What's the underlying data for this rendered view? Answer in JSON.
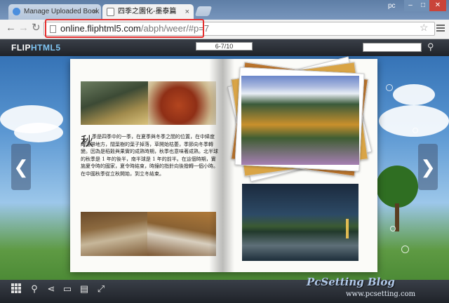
{
  "browser": {
    "tabs": [
      {
        "label": "Manage Uploaded Book",
        "active": false
      },
      {
        "label": "四季之園化-墨泰篇",
        "active": true
      }
    ],
    "close_glyph": "×",
    "user_label": "pc",
    "window_buttons": {
      "minimize": "–",
      "maximize": "□",
      "close": "✕"
    },
    "nav": {
      "back": "←",
      "forward": "→",
      "reload": "↻"
    },
    "address": {
      "domain": "online.fliphtml5.com",
      "path": "/abph/weer/#p=7"
    },
    "star_icon": "☆"
  },
  "viewer": {
    "logo_a": "FLIP",
    "logo_b": "HTML5",
    "page_indicator": "6-7/10",
    "search_placeholder": "",
    "search_icon": "⚲",
    "prev_arrow": "❮",
    "next_arrow": "❯",
    "book": {
      "initial": "秋",
      "paragraph": "季是四季中的一季，在夏季與冬季之間的位置，在中緯度的溫帶地方，闊葉樹的葉子掉落，草開始枯萎，季節向冬季轉變。因為是稻穀與果實的成熟時期，秋季也意味著成熟。北半球的秋季是 1 年的後半，南半球是 1 年的前半。在這個時期，實施夏令時的國家，夏令時結束，時鐘的指針向後撥轉一個小時。在中國秋季從立秋開始，到立冬結束。"
    },
    "toolbar_icons": [
      "thumbnails-icon",
      "zoom-icon",
      "share-icon",
      "bookmark-icon",
      "print-icon",
      "fullscreen-icon"
    ],
    "toolbar_glyphs": {
      "zoom": "⚲",
      "share": "⋖",
      "bookmark": "▭",
      "print": "▤",
      "fullscreen": "⤢"
    }
  },
  "watermark": {
    "title": "PcSetting Blog",
    "url": "www.pcsetting.com"
  }
}
